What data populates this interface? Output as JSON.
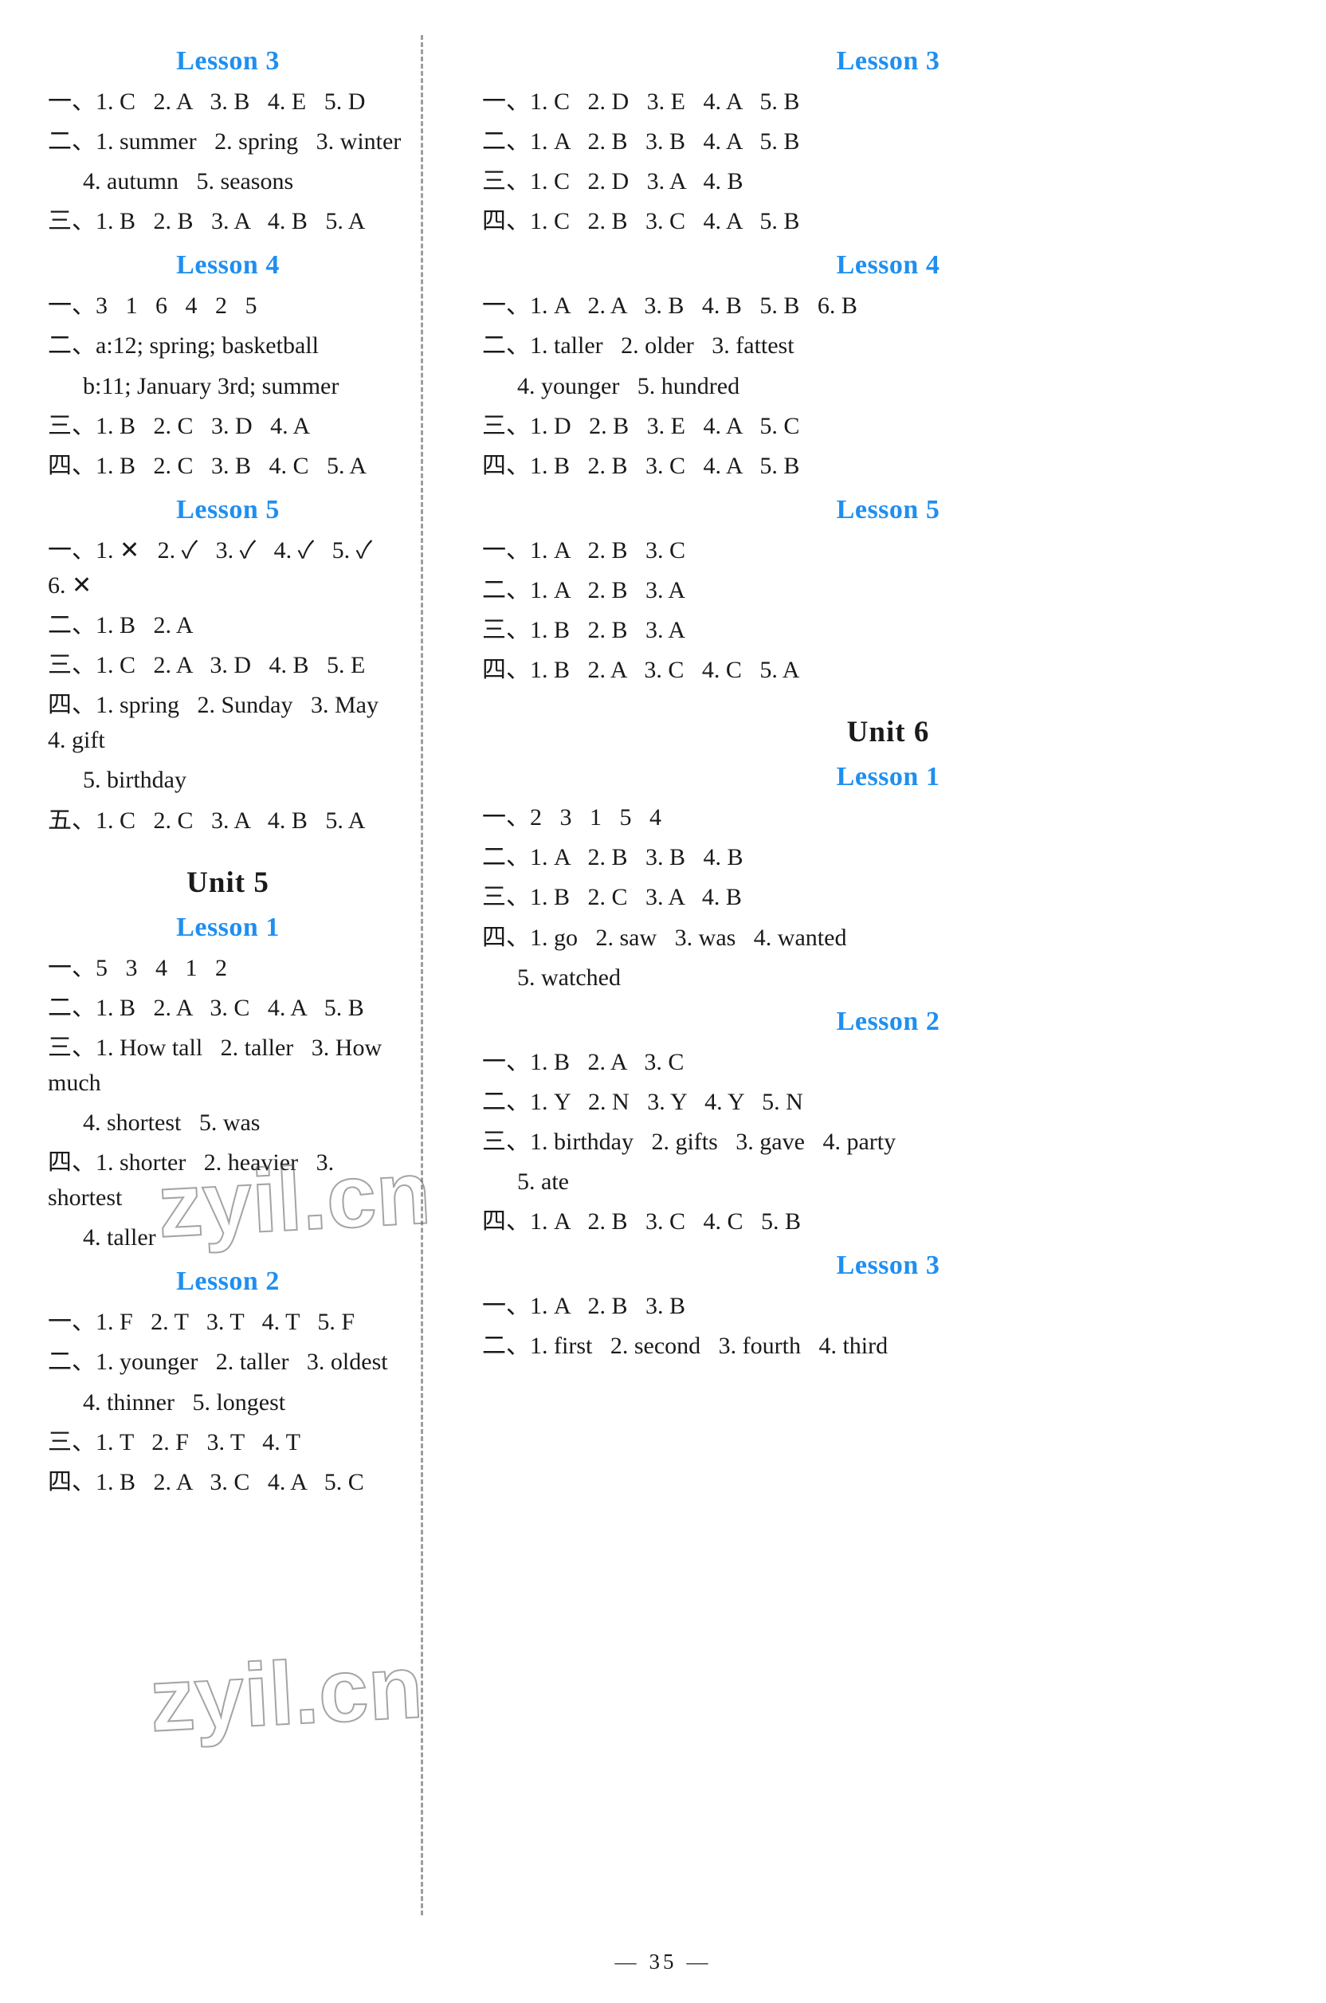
{
  "page": {
    "number": "35",
    "footer_left_dash": "—",
    "footer_right_dash": "—",
    "watermark_text": "zyil.cn",
    "accent_color": "#1f8ff0"
  },
  "left_column": {
    "sections": [
      {
        "heading": "Lesson 3",
        "heading_type": "lesson",
        "lines": [
          {
            "text": "一、1. C   2. A   3. B   4. E   5. D",
            "indent": false
          },
          {
            "text": "二、1. summer   2. spring   3. winter",
            "indent": false
          },
          {
            "text": "4. autumn   5. seasons",
            "indent": true
          },
          {
            "text": "三、1. B   2. B   3. A   4. B   5. A",
            "indent": false
          }
        ]
      },
      {
        "heading": "Lesson 4",
        "heading_type": "lesson",
        "lines": [
          {
            "text": "一、3   1   6   4   2   5",
            "indent": false
          },
          {
            "text": "二、a:12; spring; basketball",
            "indent": false
          },
          {
            "text": "b:11; January 3rd; summer",
            "indent": true
          },
          {
            "text": "三、1. B   2. C   3. D   4. A",
            "indent": false
          },
          {
            "text": "四、1. B   2. C   3. B   4. C   5. A",
            "indent": false
          }
        ]
      },
      {
        "heading": "Lesson 5",
        "heading_type": "lesson",
        "lines": [
          {
            "text": "一、1. ✕   2. ✓   3. ✓   4. ✓   5. ✓   6. ✕",
            "indent": false
          },
          {
            "text": "二、1. B   2. A",
            "indent": false
          },
          {
            "text": "三、1. C   2. A   3. D   4. B   5. E",
            "indent": false
          },
          {
            "text": "四、1. spring   2. Sunday   3. May   4. gift",
            "indent": false
          },
          {
            "text": "5. birthday",
            "indent": true
          },
          {
            "text": "五、1. C   2. C   3. A   4. B   5. A",
            "indent": false
          }
        ]
      },
      {
        "heading": "Unit 5",
        "heading_type": "unit",
        "lines": []
      },
      {
        "heading": "Lesson 1",
        "heading_type": "lesson",
        "lines": [
          {
            "text": "一、5   3   4   1   2",
            "indent": false
          },
          {
            "text": "二、1. B   2. A   3. C   4. A   5. B",
            "indent": false
          },
          {
            "text": "三、1. How tall   2. taller   3. How much",
            "indent": false
          },
          {
            "text": "4. shortest   5. was",
            "indent": true
          },
          {
            "text": "四、1. shorter   2. heavier   3. shortest",
            "indent": false
          },
          {
            "text": "4. taller",
            "indent": true
          }
        ]
      },
      {
        "heading": "Lesson 2",
        "heading_type": "lesson",
        "lines": [
          {
            "text": "一、1. F   2. T   3. T   4. T   5. F",
            "indent": false
          },
          {
            "text": "二、1. younger   2. taller   3. oldest",
            "indent": false
          },
          {
            "text": "4. thinner   5. longest",
            "indent": true
          },
          {
            "text": "三、1. T   2. F   3. T   4. T",
            "indent": false
          },
          {
            "text": "四、1. B   2. A   3. C   4. A   5. C",
            "indent": false
          }
        ]
      }
    ]
  },
  "right_column": {
    "sections": [
      {
        "heading": "Lesson 3",
        "heading_type": "lesson",
        "lines": [
          {
            "text": "一、1. C   2. D   3. E   4. A   5. B",
            "indent": false
          },
          {
            "text": "二、1. A   2. B   3. B   4. A   5. B",
            "indent": false
          },
          {
            "text": "三、1. C   2. D   3. A   4. B",
            "indent": false
          },
          {
            "text": "四、1. C   2. B   3. C   4. A   5. B",
            "indent": false
          }
        ]
      },
      {
        "heading": "Lesson 4",
        "heading_type": "lesson",
        "lines": [
          {
            "text": "一、1. A   2. A   3. B   4. B   5. B   6. B",
            "indent": false
          },
          {
            "text": "二、1. taller   2. older   3. fattest",
            "indent": false
          },
          {
            "text": "4. younger   5. hundred",
            "indent": true
          },
          {
            "text": "三、1. D   2. B   3. E   4. A   5. C",
            "indent": false
          },
          {
            "text": "四、1. B   2. B   3. C   4. A   5. B",
            "indent": false
          }
        ]
      },
      {
        "heading": "Lesson 5",
        "heading_type": "lesson",
        "lines": [
          {
            "text": "一、1. A   2. B   3. C",
            "indent": false
          },
          {
            "text": "二、1. A   2. B   3. A",
            "indent": false
          },
          {
            "text": "三、1. B   2. B   3. A",
            "indent": false
          },
          {
            "text": "四、1. B   2. A   3. C   4. C   5. A",
            "indent": false
          }
        ]
      },
      {
        "heading": "Unit 6",
        "heading_type": "unit",
        "lines": []
      },
      {
        "heading": "Lesson 1",
        "heading_type": "lesson",
        "lines": [
          {
            "text": "一、2   3   1   5   4",
            "indent": false
          },
          {
            "text": "二、1. A   2. B   3. B   4. B",
            "indent": false
          },
          {
            "text": "三、1. B   2. C   3. A   4. B",
            "indent": false
          },
          {
            "text": "四、1. go   2. saw   3. was   4. wanted",
            "indent": false
          },
          {
            "text": "5. watched",
            "indent": true
          }
        ]
      },
      {
        "heading": "Lesson 2",
        "heading_type": "lesson",
        "lines": [
          {
            "text": "一、1. B   2. A   3. C",
            "indent": false
          },
          {
            "text": "二、1. Y   2. N   3. Y   4. Y   5. N",
            "indent": false
          },
          {
            "text": "三、1. birthday   2. gifts   3. gave   4. party",
            "indent": false
          },
          {
            "text": "5. ate",
            "indent": true
          },
          {
            "text": "四、1. A   2. B   3. C   4. C   5. B",
            "indent": false
          }
        ]
      },
      {
        "heading": "Lesson 3",
        "heading_type": "lesson",
        "lines": [
          {
            "text": "一、1. A   2. B   3. B",
            "indent": false
          },
          {
            "text": "二、1. first   2. second   3. fourth   4. third",
            "indent": false
          }
        ]
      }
    ]
  }
}
